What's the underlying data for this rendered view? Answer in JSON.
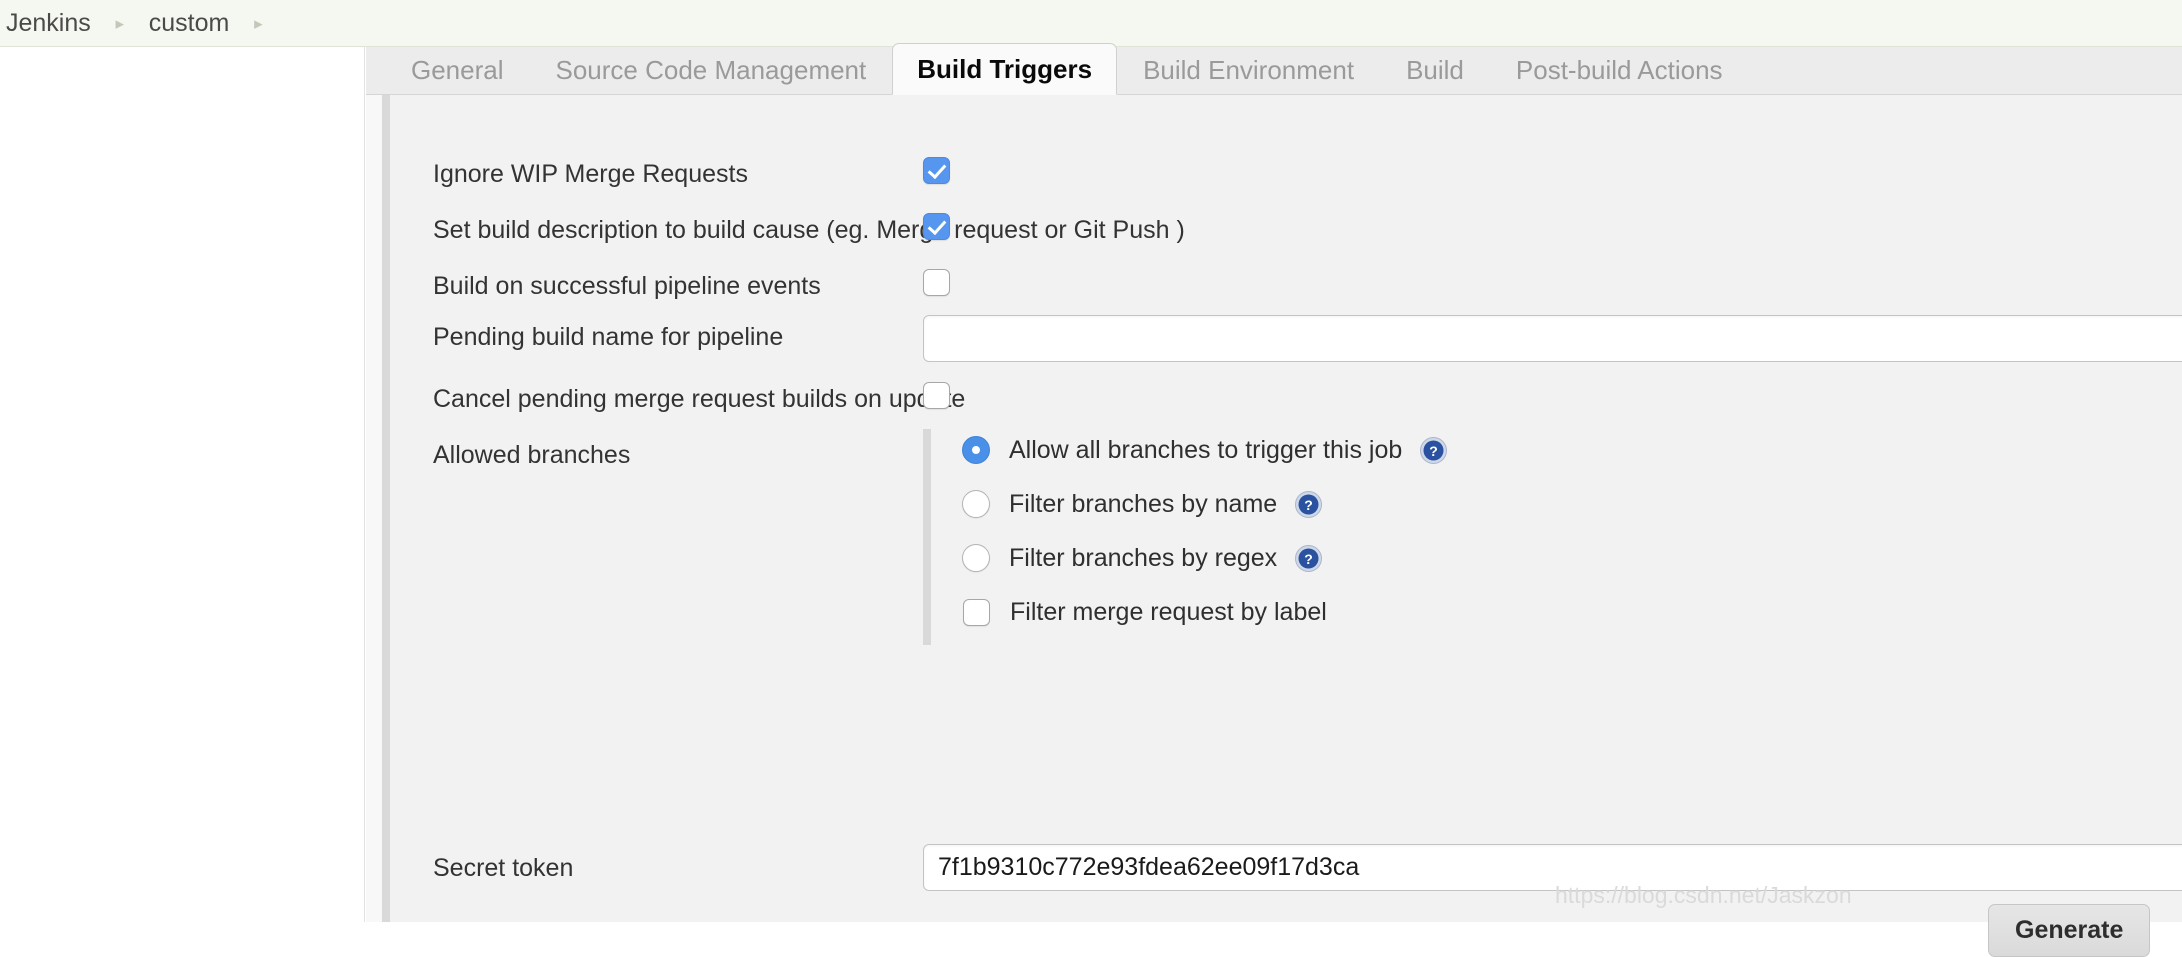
{
  "breadcrumb": {
    "items": [
      {
        "label": "Jenkins"
      },
      {
        "label": "custom"
      }
    ],
    "separator": "▸"
  },
  "tabs": [
    {
      "label": "General",
      "active": false
    },
    {
      "label": "Source Code Management",
      "active": false
    },
    {
      "label": "Build Triggers",
      "active": true
    },
    {
      "label": "Build Environment",
      "active": false
    },
    {
      "label": "Build",
      "active": false
    },
    {
      "label": "Post-build Actions",
      "active": false
    }
  ],
  "form": {
    "ignore_wip": {
      "label": "Ignore WIP Merge Requests",
      "checked": true
    },
    "set_build_description": {
      "label": "Set build description to build cause (eg. Merge request or Git Push )",
      "checked": true
    },
    "build_on_pipeline_events": {
      "label": "Build on successful pipeline events",
      "checked": false
    },
    "pending_build_name": {
      "label": "Pending build name for pipeline",
      "value": "",
      "placeholder": ""
    },
    "cancel_pending_builds": {
      "label": "Cancel pending merge request builds on update",
      "checked": false
    },
    "allowed_branches": {
      "label": "Allowed branches",
      "options": [
        {
          "label": "Allow all branches to trigger this job",
          "type": "radio",
          "selected": true,
          "help": true
        },
        {
          "label": "Filter branches by name",
          "type": "radio",
          "selected": false,
          "help": true
        },
        {
          "label": "Filter branches by regex",
          "type": "radio",
          "selected": false,
          "help": true
        },
        {
          "label": "Filter merge request by label",
          "type": "checkbox",
          "selected": false,
          "help": false
        }
      ]
    },
    "secret_token": {
      "label": "Secret token",
      "value": "7f1b9310c772e93fdea62ee09f17d3ca",
      "placeholder": ""
    },
    "generate_button": {
      "label": "Generate"
    }
  },
  "watermark": {
    "text": "https://blog.csdn.net/Jaskzon"
  },
  "colors": {
    "accent_checkbox": "#5696ef",
    "accent_radio": "#4a90e8",
    "breadcrumb_bg": "#f5f8f0",
    "content_bg": "#f2f2f2",
    "tabbar_bg": "#ececec"
  }
}
